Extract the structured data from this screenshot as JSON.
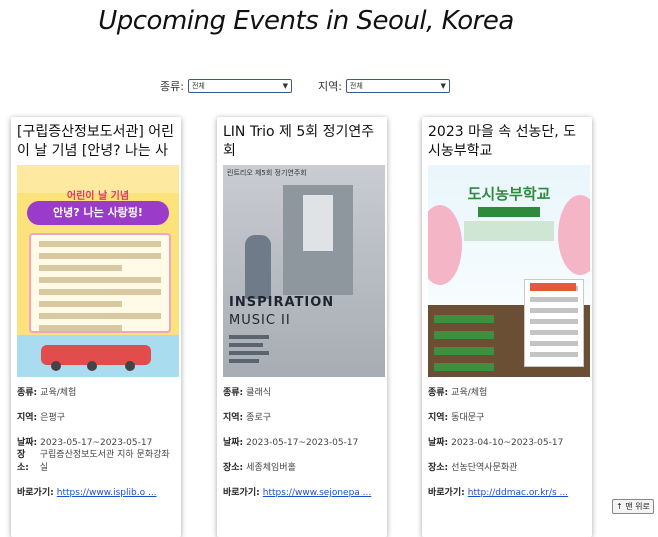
{
  "page": {
    "title": "Upcoming Events in Seoul, Korea"
  },
  "filters": {
    "category_label": "종류:",
    "category_value": "전체",
    "region_label": "지역:",
    "region_value": "전체"
  },
  "labels": {
    "category": "종류:",
    "region": "지역:",
    "date": "날짜:",
    "place": "장소:",
    "link": "바로가기:"
  },
  "cards": [
    {
      "title": "[구립증산정보도서관] 어린이 날 기념 [안녕? 나는 사랑",
      "poster": {
        "line1": "어린이 날 기념",
        "line2": "안녕? 나는 사랑핑!"
      },
      "category": "교육/체험",
      "region": "은평구",
      "date": "2023-05-17~2023-05-17",
      "place": "구립증산정보도서관 지하 문화강좌실",
      "link": "https://www.isplib.o ..."
    },
    {
      "title": "LIN Trio 제 5회 정기연주회",
      "poster": {
        "top": "린트리오 제5회 정기연주회",
        "line1": "INSPIRATION",
        "line2": "MUSIC II"
      },
      "category": "클래식",
      "region": "종로구",
      "date": "2023-05-17~2023-05-17",
      "place": "세종체임버홀",
      "link": "https://www.sejonepa ..."
    },
    {
      "title": "2023 마을 속 선농단, 도시농부학교",
      "poster": {
        "line1": "도시농부학교"
      },
      "category": "교육/체험",
      "region": "동대문구",
      "date": "2023-04-10~2023-05-17",
      "place": "선농단역사문화관",
      "link": "http://ddmac.or.kr/s ..."
    }
  ],
  "back_to_top": "↑ 맨 위로",
  "colors": {
    "link": "#1a4fd0",
    "select_border": "#3c5a8c"
  }
}
